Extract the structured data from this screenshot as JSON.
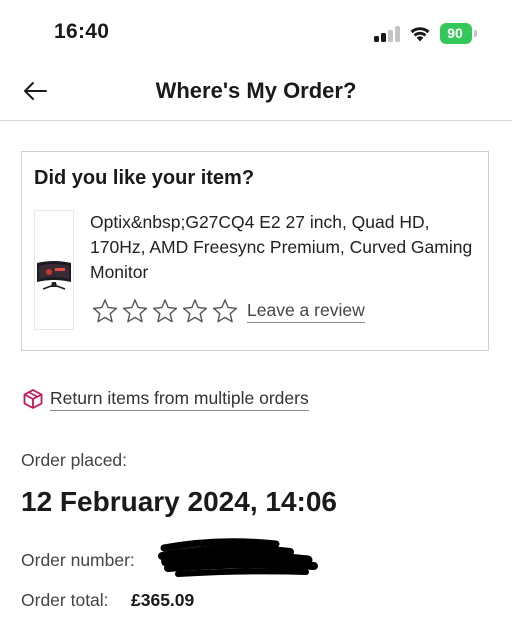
{
  "status_bar": {
    "time": "16:40",
    "battery": "90",
    "battery_color": "#34c759"
  },
  "header": {
    "title": "Where's My Order?",
    "back_icon": "arrow-left-icon"
  },
  "review_card": {
    "heading": "Did you like your item?",
    "product_name": "Optix&nbsp;G27CQ4 E2 27 inch, Quad HD, 170Hz, AMD Freesync Premium, Curved Gaming Monitor",
    "star_count": 5,
    "review_link": "Leave a review"
  },
  "returns": {
    "icon": "box-icon",
    "icon_color": "#c2185b",
    "link": "Return items from multiple orders"
  },
  "order": {
    "placed_label": "Order placed:",
    "placed_date": "12 February 2024, 14:06",
    "number_label": "Order number:",
    "number_value": "6",
    "total_label": "Order total:",
    "total_value": "£365.09"
  }
}
